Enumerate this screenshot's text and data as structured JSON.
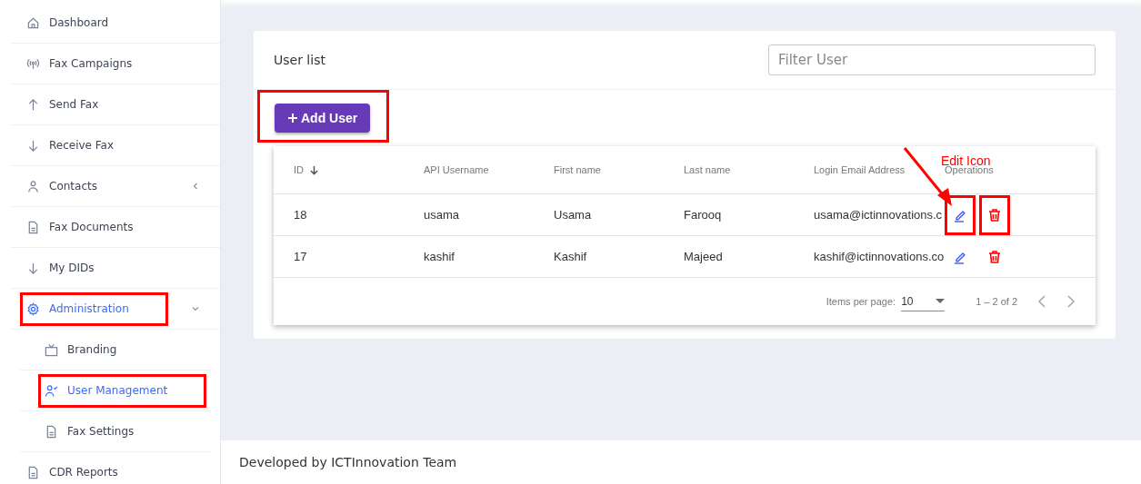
{
  "sidebar": {
    "items": [
      {
        "label": "Dashboard",
        "selected": false,
        "highlighted": false
      },
      {
        "label": "Fax Campaigns",
        "selected": false,
        "highlighted": false
      },
      {
        "label": "Send Fax",
        "selected": false,
        "highlighted": false
      },
      {
        "label": "Receive Fax",
        "selected": false,
        "highlighted": false
      },
      {
        "label": "Contacts",
        "selected": false,
        "highlighted": false,
        "expanded": false
      },
      {
        "label": "Fax Documents",
        "selected": false,
        "highlighted": false
      },
      {
        "label": "My DIDs",
        "selected": false,
        "highlighted": false
      },
      {
        "label": "Administration",
        "selected": true,
        "highlighted": true,
        "expanded": true,
        "children": [
          {
            "label": "Branding",
            "selected": false,
            "highlighted": false
          },
          {
            "label": "User Management",
            "selected": true,
            "highlighted": true
          },
          {
            "label": "Fax Settings",
            "selected": false,
            "highlighted": false
          }
        ]
      },
      {
        "label": "CDR Reports",
        "selected": false,
        "highlighted": false
      }
    ]
  },
  "card": {
    "title": "User list",
    "filter": {
      "placeholder": "Filter User"
    },
    "add_button": {
      "label": "Add User",
      "highlighted": true
    }
  },
  "table": {
    "columns": [
      {
        "label": "ID",
        "sorted": true
      },
      {
        "label": "API Username",
        "sorted": false
      },
      {
        "label": "First name",
        "sorted": false
      },
      {
        "label": "Last name",
        "sorted": false
      },
      {
        "label": "Login Email Address",
        "sorted": false
      },
      {
        "label": "Operations",
        "sorted": false
      }
    ],
    "rows": [
      {
        "cells": [
          "18",
          "usama",
          "Usama",
          "Farooq",
          "usama@ictinnovations.c"
        ],
        "highlighted": true
      },
      {
        "cells": [
          "17",
          "kashif",
          "Kashif",
          "Majeed",
          "kashif@ictinnovations.co"
        ],
        "highlighted": false
      }
    ]
  },
  "paginator": {
    "label": "Items per page:",
    "page_size": "10",
    "range": "1 – 2 of 2"
  },
  "annotation": {
    "text": "Edit Icon"
  },
  "footer": "Developed by ICTInnovation Team"
}
